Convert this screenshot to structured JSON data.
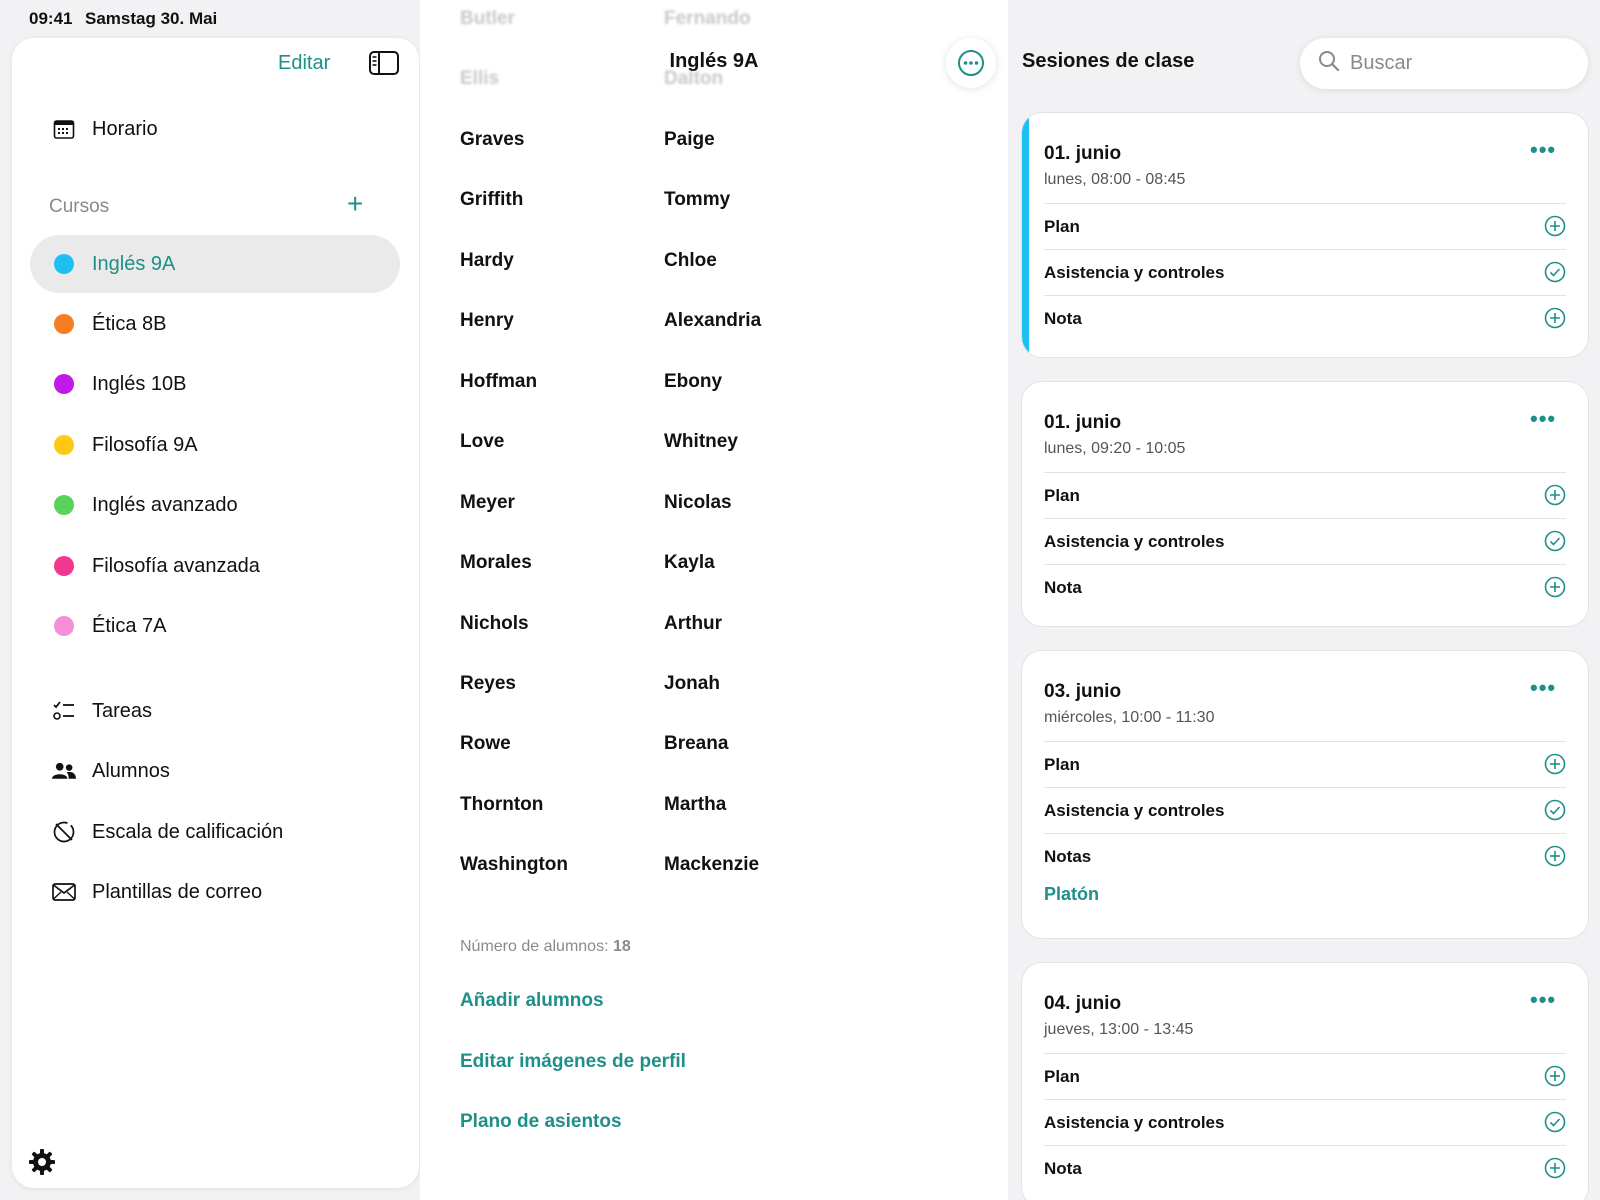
{
  "status": {
    "time": "09:41",
    "date": "Samstag 30. Mai"
  },
  "sidebar": {
    "edit_label": "Editar",
    "schedule_label": "Horario",
    "courses_label": "Cursos",
    "courses": [
      {
        "label": "Inglés 9A",
        "color": "#1ec0f2"
      },
      {
        "label": "Ética 8B",
        "color": "#f57c1f"
      },
      {
        "label": "Inglés 10B",
        "color": "#c319e8"
      },
      {
        "label": "Filosofía 9A",
        "color": "#ffc814"
      },
      {
        "label": "Inglés avanzado",
        "color": "#5ad15a"
      },
      {
        "label": "Filosofía avanzada",
        "color": "#f2378f"
      },
      {
        "label": "Ética 7A",
        "color": "#f78fd8"
      }
    ],
    "tools": [
      {
        "label": "Tareas",
        "icon": "checklist-icon"
      },
      {
        "label": "Alumnos",
        "icon": "people-icon"
      },
      {
        "label": "Escala de calificación",
        "icon": "grading-scale-icon"
      },
      {
        "label": "Plantillas de correo",
        "icon": "envelope-icon"
      }
    ]
  },
  "students": {
    "title": "Inglés 9A",
    "faded_rows": [
      {
        "last": "Butler",
        "first": "Fernando"
      },
      {
        "last": "Ellis",
        "first": "Dalton"
      }
    ],
    "rows": [
      {
        "last": "Graves",
        "first": "Paige"
      },
      {
        "last": "Griffith",
        "first": "Tommy"
      },
      {
        "last": "Hardy",
        "first": "Chloe"
      },
      {
        "last": "Henry",
        "first": "Alexandria"
      },
      {
        "last": "Hoffman",
        "first": "Ebony"
      },
      {
        "last": "Love",
        "first": "Whitney"
      },
      {
        "last": "Meyer",
        "first": "Nicolas"
      },
      {
        "last": "Morales",
        "first": "Kayla"
      },
      {
        "last": "Nichols",
        "first": "Arthur"
      },
      {
        "last": "Reyes",
        "first": "Jonah"
      },
      {
        "last": "Rowe",
        "first": "Breana"
      },
      {
        "last": "Thornton",
        "first": "Martha"
      },
      {
        "last": "Washington",
        "first": "Mackenzie"
      }
    ],
    "count_label": "Número de alumnos:",
    "count_value": "18",
    "add_link": "Añadir alumnos",
    "edit_images_link": "Editar imágenes de perfil",
    "seating_link": "Plano de asientos"
  },
  "sessions": {
    "title": "Sesiones de clase",
    "search_placeholder": "Buscar",
    "cards": [
      {
        "date": "01. junio",
        "time": "lunes, 08:00 - 08:45",
        "plan": "Plan",
        "attendance": "Asistencia y controles",
        "notes": "Nota",
        "note_link": ""
      },
      {
        "date": "01. junio",
        "time": "lunes, 09:20 - 10:05",
        "plan": "Plan",
        "attendance": "Asistencia y controles",
        "notes": "Nota",
        "note_link": ""
      },
      {
        "date": "03. junio",
        "time": "miércoles, 10:00 - 11:30",
        "plan": "Plan",
        "attendance": "Asistencia y controles",
        "notes": "Notas",
        "note_link": "Platón"
      },
      {
        "date": "04. junio",
        "time": "jueves, 13:00 - 13:45",
        "plan": "Plan",
        "attendance": "Asistencia y controles",
        "notes": "Nota",
        "note_link": ""
      }
    ]
  },
  "colors": {
    "accent": "#1f8f89",
    "current_session": "#1ec0f2"
  }
}
